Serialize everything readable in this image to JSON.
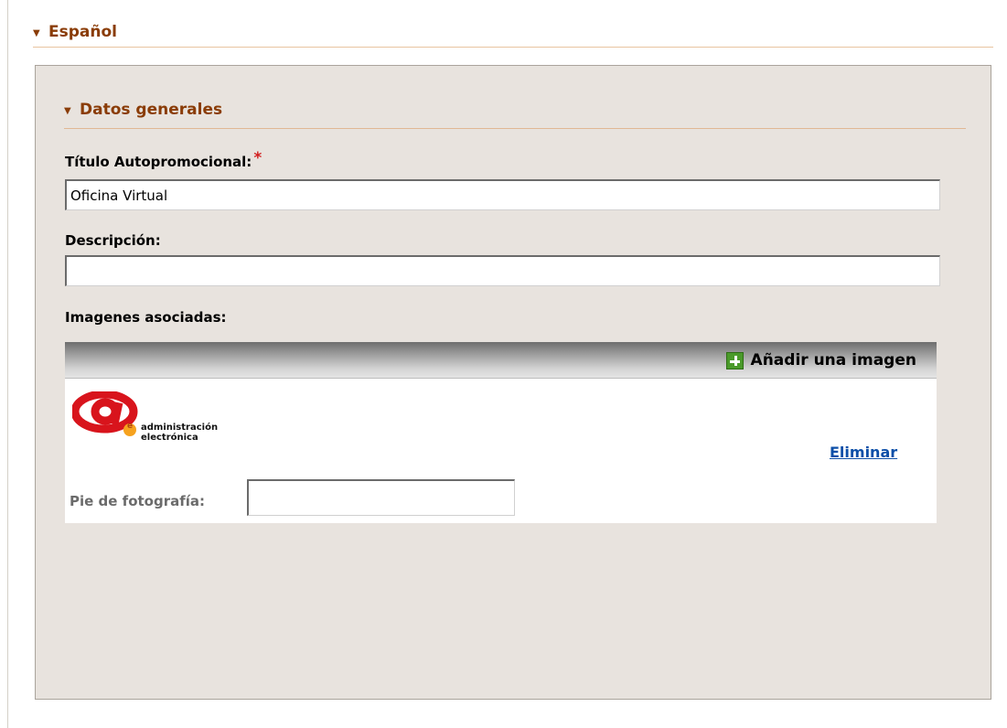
{
  "section": {
    "title": "Español"
  },
  "datos_generales": {
    "title": "Datos generales",
    "required_marker": "*",
    "titulo_label": "Título Autopromocional:",
    "titulo_value": "Oficina Virtual",
    "descripcion_label": "Descripción:",
    "descripcion_value": ""
  },
  "imagenes": {
    "label": "Imagenes asociadas:",
    "add_label": "Añadir una imagen",
    "logo_line1": "administración",
    "logo_line2": "electrónica",
    "delete_label": "Eliminar",
    "caption_label": "Pie de fotografía:",
    "caption_value": ""
  },
  "colors": {
    "accent": "#8a3c07",
    "panel_bg": "#e8e3de",
    "link": "#0d4fa8",
    "required": "#d21e1e"
  },
  "icons": {
    "section_bullet": "triangle-down-icon",
    "add_image": "plus-icon"
  }
}
